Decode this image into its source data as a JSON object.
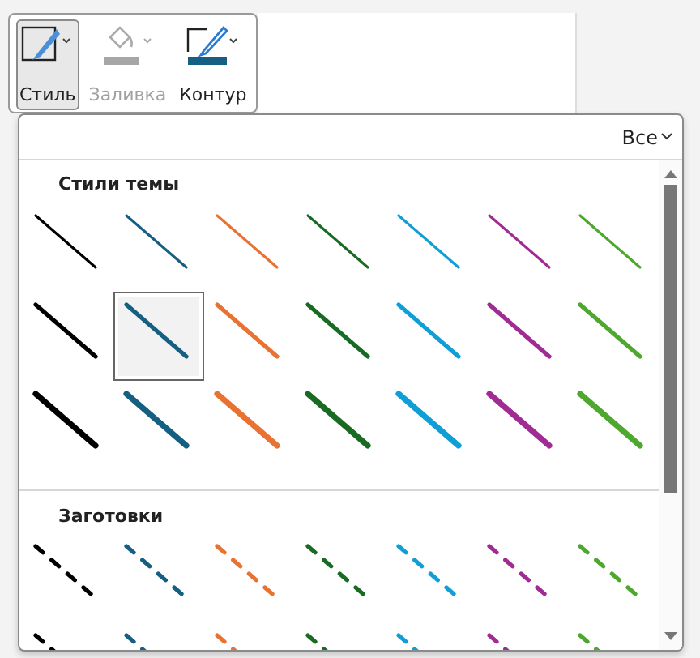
{
  "toolbar": {
    "buttons": [
      {
        "kind": "style",
        "label": "Стиль",
        "selected": true,
        "disabled": false
      },
      {
        "kind": "fill",
        "label": "Заливка",
        "selected": false,
        "disabled": true
      },
      {
        "kind": "outline",
        "label": "Контур",
        "selected": false,
        "disabled": false
      }
    ]
  },
  "gallery": {
    "filter": "Все",
    "sections": [
      {
        "title": "Стили темы",
        "rows": [
          {
            "kind": "thin",
            "swatches": [
              {
                "color": "#000000",
                "selected": false
              },
              {
                "color": "#156082",
                "selected": false
              },
              {
                "color": "#e97132",
                "selected": false
              },
              {
                "color": "#196b24",
                "selected": false
              },
              {
                "color": "#0f9ed5",
                "selected": false
              },
              {
                "color": "#a02b93",
                "selected": false
              },
              {
                "color": "#4ea72e",
                "selected": false
              }
            ]
          },
          {
            "kind": "medium",
            "swatches": [
              {
                "color": "#000000",
                "selected": false
              },
              {
                "color": "#156082",
                "selected": true
              },
              {
                "color": "#e97132",
                "selected": false
              },
              {
                "color": "#196b24",
                "selected": false
              },
              {
                "color": "#0f9ed5",
                "selected": false
              },
              {
                "color": "#a02b93",
                "selected": false
              },
              {
                "color": "#4ea72e",
                "selected": false
              }
            ]
          },
          {
            "kind": "thick",
            "swatches": [
              {
                "color": "#000000",
                "selected": false
              },
              {
                "color": "#156082",
                "selected": false
              },
              {
                "color": "#e97132",
                "selected": false
              },
              {
                "color": "#196b24",
                "selected": false
              },
              {
                "color": "#0f9ed5",
                "selected": false
              },
              {
                "color": "#a02b93",
                "selected": false
              },
              {
                "color": "#4ea72e",
                "selected": false
              }
            ]
          }
        ]
      },
      {
        "title": "Заготовки",
        "rows": [
          {
            "kind": "dashed",
            "swatches": [
              {
                "color": "#000000",
                "selected": false
              },
              {
                "color": "#156082",
                "selected": false
              },
              {
                "color": "#e97132",
                "selected": false
              },
              {
                "color": "#196b24",
                "selected": false
              },
              {
                "color": "#0f9ed5",
                "selected": false
              },
              {
                "color": "#a02b93",
                "selected": false
              },
              {
                "color": "#4ea72e",
                "selected": false
              }
            ]
          },
          {
            "kind": "dashed",
            "swatches": [
              {
                "color": "#000000",
                "selected": false
              },
              {
                "color": "#156082",
                "selected": false
              },
              {
                "color": "#e97132",
                "selected": false
              },
              {
                "color": "#196b24",
                "selected": false
              },
              {
                "color": "#0f9ed5",
                "selected": false
              },
              {
                "color": "#a02b93",
                "selected": false
              },
              {
                "color": "#4ea72e",
                "selected": false
              }
            ]
          }
        ]
      }
    ]
  }
}
